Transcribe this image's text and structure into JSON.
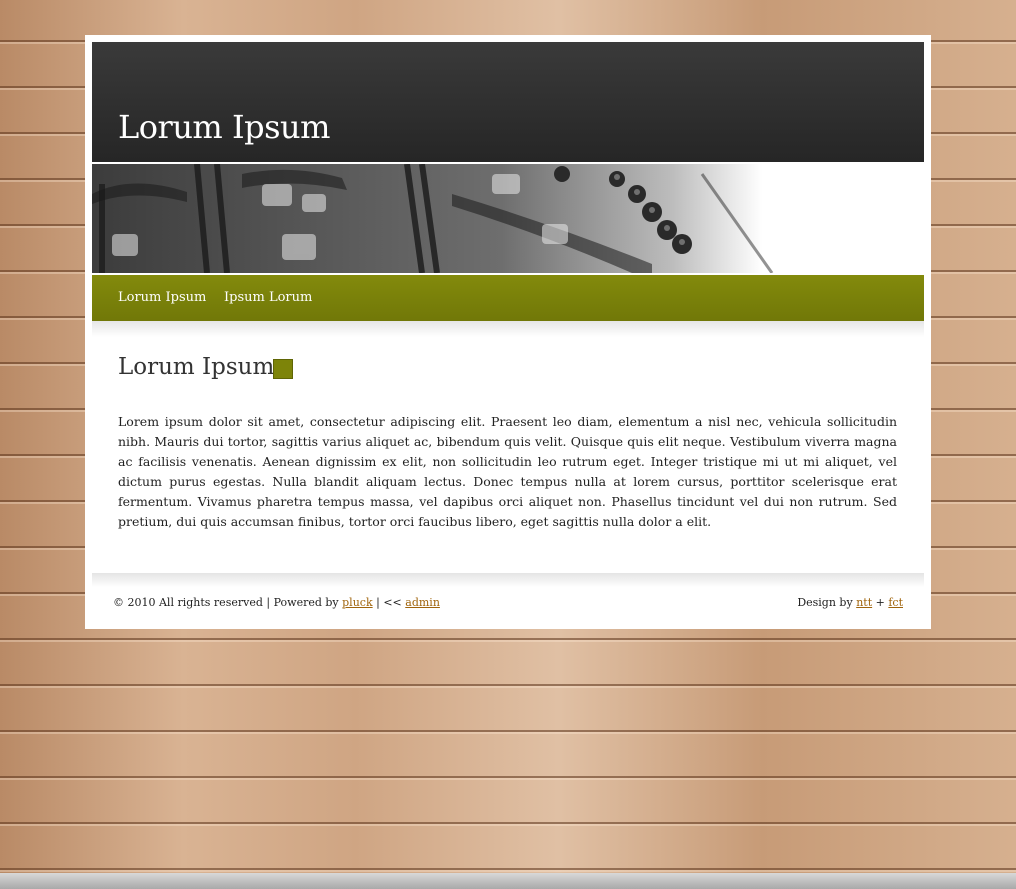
{
  "header": {
    "site_title": "Lorum Ipsum"
  },
  "nav": {
    "items": [
      {
        "label": "Lorum Ipsum"
      },
      {
        "label": "Ipsum Lorum"
      }
    ]
  },
  "main": {
    "title": "Lorum Ipsum",
    "body": "Lorem ipsum dolor sit amet, consectetur adipiscing elit. Praesent leo diam, elementum a nisl nec, vehicula sollicitudin nibh. Mauris dui tortor, sagittis varius aliquet ac, bibendum quis velit. Quisque quis elit neque. Vestibulum viverra magna ac facilisis venenatis. Aenean dignissim ex elit, non sollicitudin leo rutrum eget. Integer tristique mi ut mi aliquet, vel dictum purus egestas. Nulla blandit aliquam lectus. Donec tempus nulla at lorem cursus, porttitor scelerisque erat fermentum. Vivamus pharetra tempus massa, vel dapibus orci aliquet non. Phasellus tincidunt vel dui non rutrum. Sed pretium, dui quis accumsan finibus, tortor orci faucibus libero, eget sagittis nulla dolor a elit."
  },
  "footer": {
    "copyright": "© 2010 All rights reserved | Powered by ",
    "powered_link": "pluck",
    "separator": " | << ",
    "admin_link": "admin",
    "design_prefix": "Design by ",
    "design_link_1": "ntt",
    "plus": " + ",
    "design_link_2": "fct"
  },
  "colors": {
    "accent": "#7d8409",
    "header_bg": "#2e2e2e",
    "link": "#a0640c"
  }
}
